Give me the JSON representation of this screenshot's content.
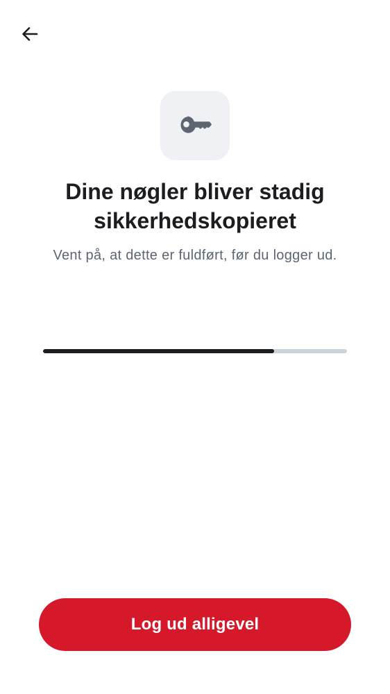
{
  "header": {
    "back_icon": "arrow-left-icon"
  },
  "hero": {
    "icon": "key-icon",
    "icon_color": "#5d6571",
    "tile_color": "#eff1f5"
  },
  "content": {
    "title": "Dine nøgler bliver stadig sikkerhedskopieret",
    "subtitle": "Vent på, at dette er fuldført, før du logger ud."
  },
  "progress": {
    "value": 0.76,
    "fill_color": "#1b1d21",
    "track_color": "#cdd3db"
  },
  "actions": {
    "logout_label": "Log ud alligevel",
    "logout_color": "#d6192a"
  }
}
